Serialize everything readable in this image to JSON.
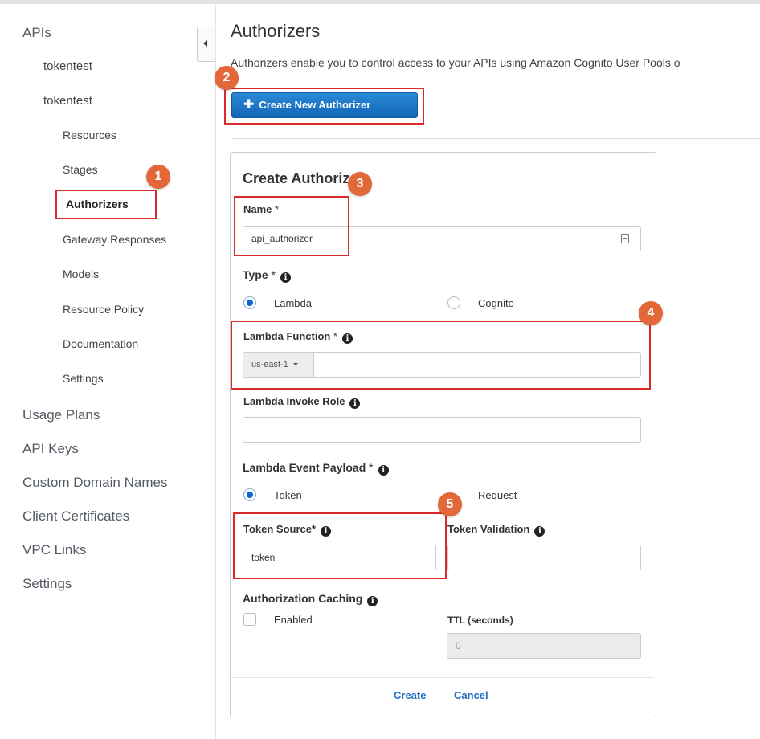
{
  "sidebar": {
    "apis": "APIs",
    "api_items": [
      "tokentest",
      "tokentest"
    ],
    "sub_items": [
      "Resources",
      "Stages",
      "Authorizers",
      "Gateway Responses",
      "Models",
      "Resource Policy",
      "Documentation",
      "Settings"
    ],
    "active_item": "Authorizers",
    "top_items": [
      "Usage Plans",
      "API Keys",
      "Custom Domain Names",
      "Client Certificates",
      "VPC Links",
      "Settings"
    ]
  },
  "main": {
    "title": "Authorizers",
    "description": "Authorizers enable you to control access to your APIs using Amazon Cognito User Pools o",
    "create_button": "Create New Authorizer"
  },
  "form": {
    "title": "Create Authorizer",
    "name_label": "Name",
    "name_value": "api_authorizer",
    "type_label": "Type",
    "type_options": [
      "Lambda",
      "Cognito"
    ],
    "type_selected": "Lambda",
    "lambda_function_label": "Lambda Function",
    "region": "us-east-1",
    "lambda_function_value": "",
    "invoke_role_label": "Lambda Invoke Role",
    "invoke_role_value": "",
    "payload_label": "Lambda Event Payload",
    "payload_options": [
      "Token",
      "Request"
    ],
    "payload_selected": "Token",
    "token_source_label": "Token Source*",
    "token_source_value": "token",
    "token_validation_label": "Token Validation",
    "token_validation_value": "",
    "caching_label": "Authorization Caching",
    "caching_enabled_label": "Enabled",
    "caching_enabled": false,
    "ttl_label": "TTL (seconds)",
    "ttl_value": "0",
    "create_link": "Create",
    "cancel_link": "Cancel",
    "required_marker": "*"
  },
  "annotations": [
    "1",
    "2",
    "3",
    "4",
    "5"
  ],
  "colors": {
    "annotation": "#d92a2a",
    "badge": "#e2683a",
    "primary": "#1466b8",
    "link": "#1f6fbf"
  }
}
